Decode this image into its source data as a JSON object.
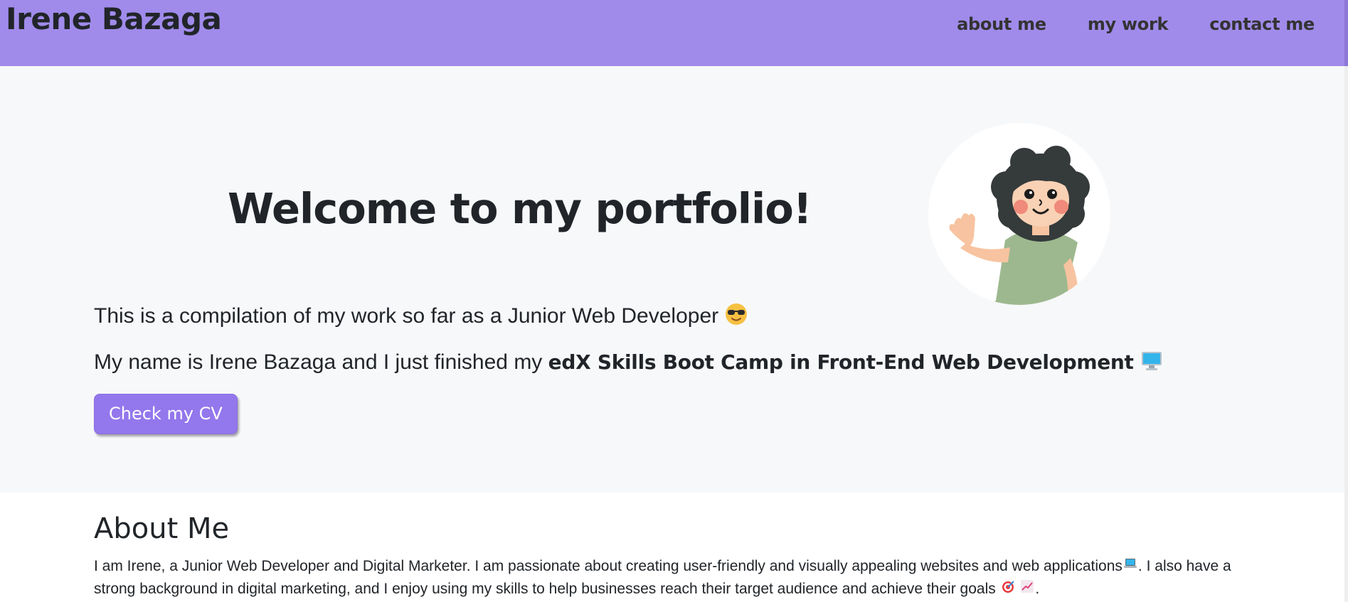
{
  "navbar": {
    "brand": "Irene Bazaga",
    "links": [
      {
        "label": "about me"
      },
      {
        "label": "my work"
      },
      {
        "label": "contact me"
      }
    ]
  },
  "hero": {
    "title": "Welcome to my portfolio!",
    "line1": "This is a compilation of my work so far as a Junior Web Developer",
    "line2_prefix": "My name is Irene Bazaga and I just finished my",
    "line2_bold": "edX Skills Boot Camp in Front-End Web Development",
    "cv_button": "Check my CV"
  },
  "about": {
    "title": "About Me",
    "text_part1": "I am Irene, a Junior Web Developer and Digital Marketer. I am passionate about creating user-friendly and visually appealing websites and web applications",
    "text_part2": ". I also have a strong background in digital marketing, and I enjoy using my skills to help businesses reach their target audience and achieve their goals",
    "text_end": "."
  },
  "colors": {
    "navbar_bg": "#a08beb",
    "button_bg": "#9377ec",
    "hero_bg": "#f7f8fa",
    "text": "#212529"
  },
  "icons": {
    "line1_emoji": "sunglasses-emoji-icon",
    "line2_emoji": "desktop-computer-icon",
    "about_laptop": "laptop-icon",
    "about_target": "target-icon",
    "about_chart": "chart-increasing-icon"
  }
}
